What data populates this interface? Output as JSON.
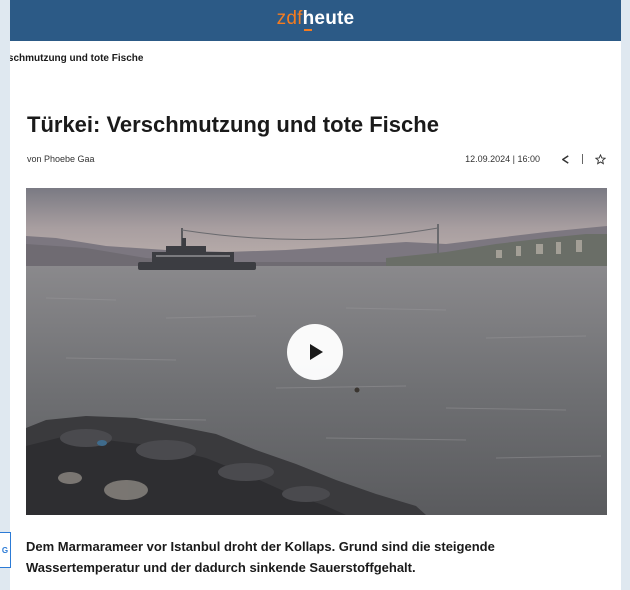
{
  "header": {
    "logo_part1": "zdf",
    "logo_part2": "heute",
    "colors": {
      "bar": "#2c5a86",
      "logo_accent": "#f47c20",
      "logo_text": "#ffffff"
    }
  },
  "breadcrumb": "rschmutzung und tote Fische",
  "article": {
    "title": "Türkei: Verschmutzung und tote Fische",
    "author": "von Phoebe Gaa",
    "datetime": "12.09.2024 | 16:00",
    "summary": "Dem Marmarameer vor Istanbul droht der Kollaps. Grund sind die steigende Wassertemperatur und der dadurch sinkende Sauerstoffgehalt."
  },
  "actions": {
    "share_icon": "share-icon",
    "bookmark_icon": "star-icon"
  },
  "video": {
    "play_icon": "play-icon"
  },
  "side_badge": {
    "label": "G",
    "color": "#2c7bd6"
  }
}
